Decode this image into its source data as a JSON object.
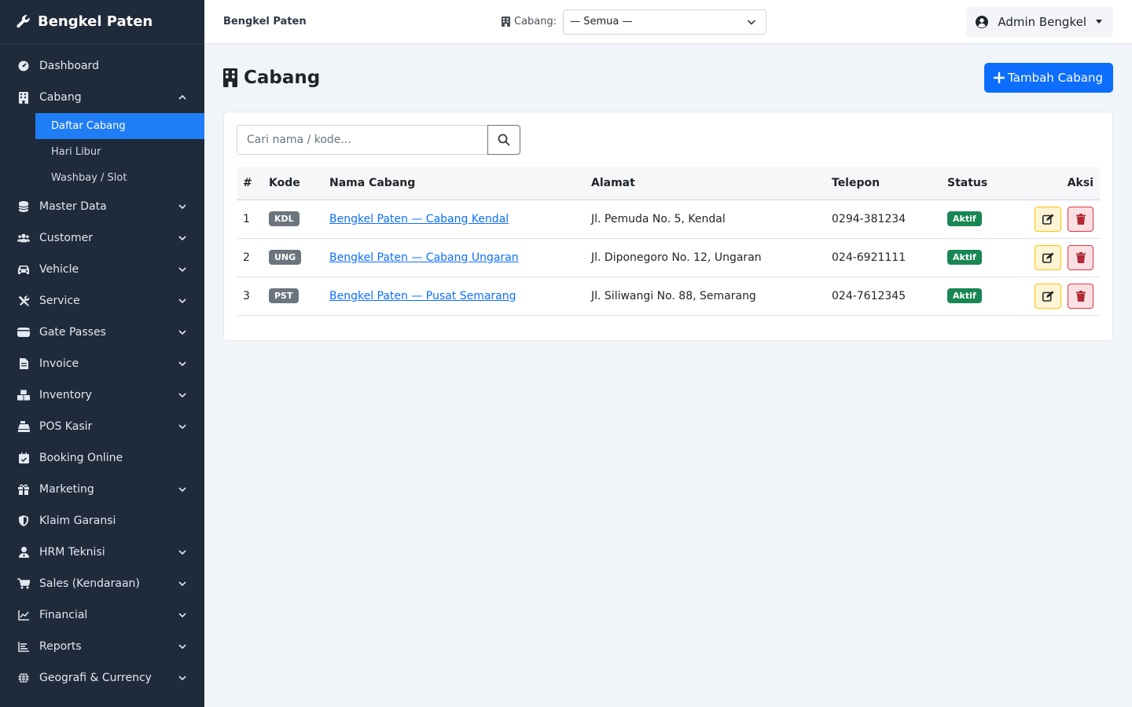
{
  "sidebar": {
    "brand": "Bengkel Paten",
    "items": [
      {
        "label": "Dashboard",
        "icon": "dashboard-icon",
        "chevron": ""
      },
      {
        "label": "Cabang",
        "icon": "building-icon",
        "chevron": "up"
      },
      {
        "label": "Master Data",
        "icon": "database-icon",
        "chevron": "down"
      },
      {
        "label": "Customer",
        "icon": "users-icon",
        "chevron": "down"
      },
      {
        "label": "Vehicle",
        "icon": "car-icon",
        "chevron": "down"
      },
      {
        "label": "Service",
        "icon": "tools-icon",
        "chevron": "down"
      },
      {
        "label": "Gate Passes",
        "icon": "id-card-icon",
        "chevron": "down"
      },
      {
        "label": "Invoice",
        "icon": "file-invoice-icon",
        "chevron": "down"
      },
      {
        "label": "Inventory",
        "icon": "boxes-icon",
        "chevron": "down"
      },
      {
        "label": "POS Kasir",
        "icon": "cash-register-icon",
        "chevron": "down"
      },
      {
        "label": "Booking Online",
        "icon": "calendar-check-icon",
        "chevron": ""
      },
      {
        "label": "Marketing",
        "icon": "gift-icon",
        "chevron": "down"
      },
      {
        "label": "Klaim Garansi",
        "icon": "shield-icon",
        "chevron": ""
      },
      {
        "label": "HRM Teknisi",
        "icon": "user-tie-icon",
        "chevron": "down"
      },
      {
        "label": "Sales (Kendaraan)",
        "icon": "cart-icon",
        "chevron": "down"
      },
      {
        "label": "Financial",
        "icon": "chart-line-icon",
        "chevron": "down"
      },
      {
        "label": "Reports",
        "icon": "list-icon",
        "chevron": "down"
      },
      {
        "label": "Geografi & Currency",
        "icon": "globe-icon",
        "chevron": "down"
      }
    ],
    "cabang_sub": [
      {
        "label": "Daftar Cabang",
        "active": true
      },
      {
        "label": "Hari Libur",
        "active": false
      },
      {
        "label": "Washbay / Slot",
        "active": false
      }
    ]
  },
  "topbar": {
    "app_name": "Bengkel Paten",
    "branch_label": "Cabang:",
    "branch_value": "— Semua —",
    "user_name": "Admin Bengkel"
  },
  "page": {
    "title": "Cabang",
    "add_button": "Tambah Cabang",
    "search_placeholder": "Cari nama / kode..."
  },
  "table": {
    "headers": [
      "#",
      "Kode",
      "Nama Cabang",
      "Alamat",
      "Telepon",
      "Status",
      "Aksi"
    ],
    "rows": [
      {
        "no": "1",
        "kode": "KDL",
        "nama": "Bengkel Paten — Cabang Kendal",
        "alamat": "Jl. Pemuda No. 5, Kendal",
        "telepon": "0294-381234",
        "status": "Aktif"
      },
      {
        "no": "2",
        "kode": "UNG",
        "nama": "Bengkel Paten — Cabang Ungaran",
        "alamat": "Jl. Diponegoro No. 12, Ungaran",
        "telepon": "024-6921111",
        "status": "Aktif"
      },
      {
        "no": "3",
        "kode": "PST",
        "nama": "Bengkel Paten — Pusat Semarang",
        "alamat": "Jl. Siliwangi No. 88, Semarang",
        "telepon": "024-7612345",
        "status": "Aktif"
      }
    ]
  },
  "colors": {
    "sidebar_bg": "#1f2a3a",
    "primary": "#0d6efd",
    "success": "#198754",
    "warning": "#ffc107",
    "danger": "#dc3545"
  }
}
